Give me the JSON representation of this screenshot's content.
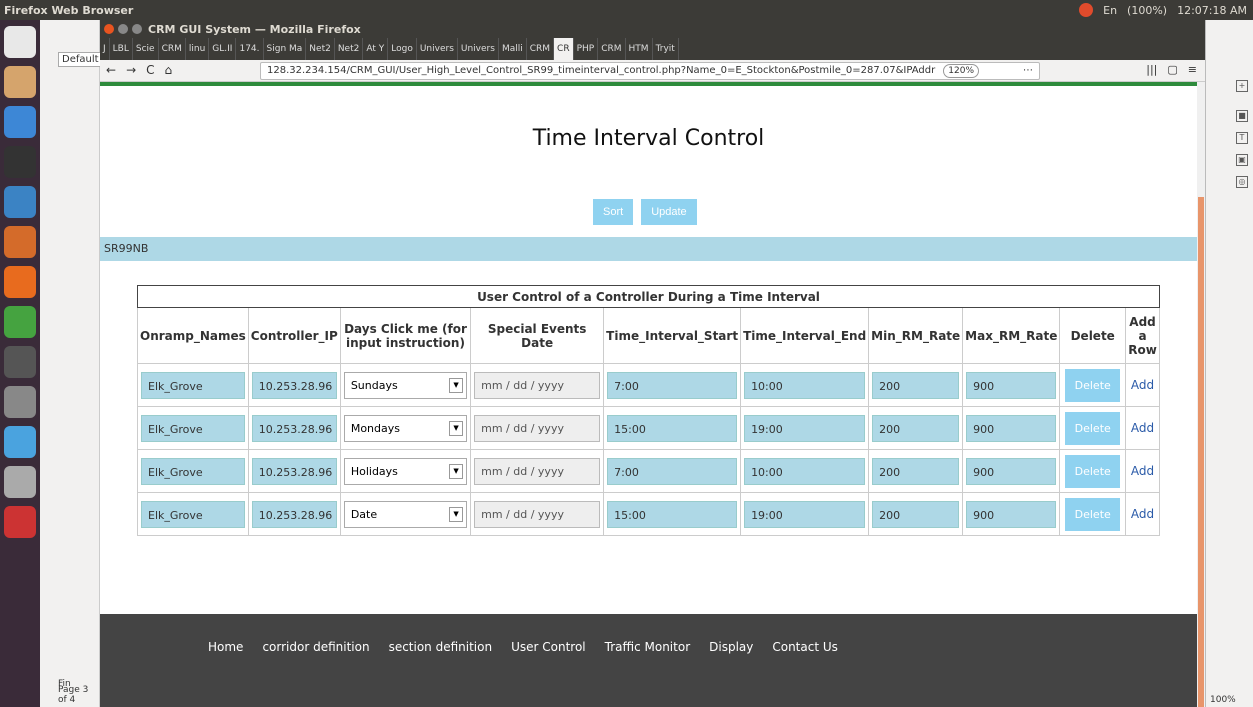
{
  "os": {
    "title": "Firefox Web Browser",
    "tray": [
      "En",
      "(100%)",
      "12:07:18 AM"
    ],
    "launcher_icons": [
      "ubuntu-logo",
      "files",
      "thunderbird",
      "terminal",
      "writer",
      "impress",
      "firefox",
      "calc",
      "unknown",
      "settings",
      "chrome",
      "assistant",
      "acrobat"
    ],
    "left_window": {
      "default_label": "Default",
      "find_label": "Fin",
      "page_label": "Page 3 of 4"
    },
    "right_window": {
      "zoom": "100%"
    }
  },
  "browser": {
    "window_title": "CRM GUI System — Mozilla Firefox",
    "tabs": [
      "J",
      "LBL",
      "Scie",
      "CRM",
      "linu",
      "GL.II",
      "174.",
      "Sign Ma",
      "Net2",
      "Net2",
      "At Y",
      "Logo",
      "Univers",
      "Univers",
      "Malli",
      "CRM",
      "CR",
      "PHP",
      "CRM",
      "HTM",
      "Tryit"
    ],
    "active_tab_index": 16,
    "url": "128.32.234.154/CRM_GUI/User_High_Level_Control_SR99_timeinterval_control.php?Name_0=E_Stockton&Postmile_0=287.07&IPAddr",
    "zoom": "120%",
    "more": "⋯"
  },
  "page": {
    "title": "Time Interval Control",
    "sort_label": "Sort",
    "update_label": "Update",
    "section": "SR99NB",
    "table_caption": "User Control of a Controller During a Time Interval",
    "headers": [
      "Onramp_Names",
      "Controller_IP",
      "Days Click me (for input instruction)",
      "Special Events Date",
      "Time_Interval_Start",
      "Time_Interval_End",
      "Min_RM_Rate",
      "Max_RM_Rate",
      "Delete",
      "Add a Row"
    ],
    "rows": [
      {
        "onramp": "Elk_Grove",
        "ip": "10.253.28.96",
        "day": "Sundays",
        "date": "mm / dd / yyyy",
        "start": "7:00",
        "end": "10:00",
        "min": "200",
        "max": "900",
        "delete": "Delete",
        "add": "Add"
      },
      {
        "onramp": "Elk_Grove",
        "ip": "10.253.28.96",
        "day": "Mondays",
        "date": "mm / dd / yyyy",
        "start": "15:00",
        "end": "19:00",
        "min": "200",
        "max": "900",
        "delete": "Delete",
        "add": "Add"
      },
      {
        "onramp": "Elk_Grove",
        "ip": "10.253.28.96",
        "day": "Holidays",
        "date": "mm / dd / yyyy",
        "start": "7:00",
        "end": "10:00",
        "min": "200",
        "max": "900",
        "delete": "Delete",
        "add": "Add"
      },
      {
        "onramp": "Elk_Grove",
        "ip": "10.253.28.96",
        "day": "Date",
        "date": "mm / dd / yyyy",
        "start": "15:00",
        "end": "19:00",
        "min": "200",
        "max": "900",
        "delete": "Delete",
        "add": "Add"
      }
    ],
    "footer_links": [
      "Home",
      "corridor definition",
      "section definition",
      "User Control",
      "Traffic Monitor",
      "Display",
      "Contact Us"
    ]
  },
  "colors": {
    "accent": "#8fd2f0",
    "cell": "#aed8e6",
    "green": "#2e8b3c",
    "footer": "#444444",
    "scroll": "#e8956b"
  }
}
